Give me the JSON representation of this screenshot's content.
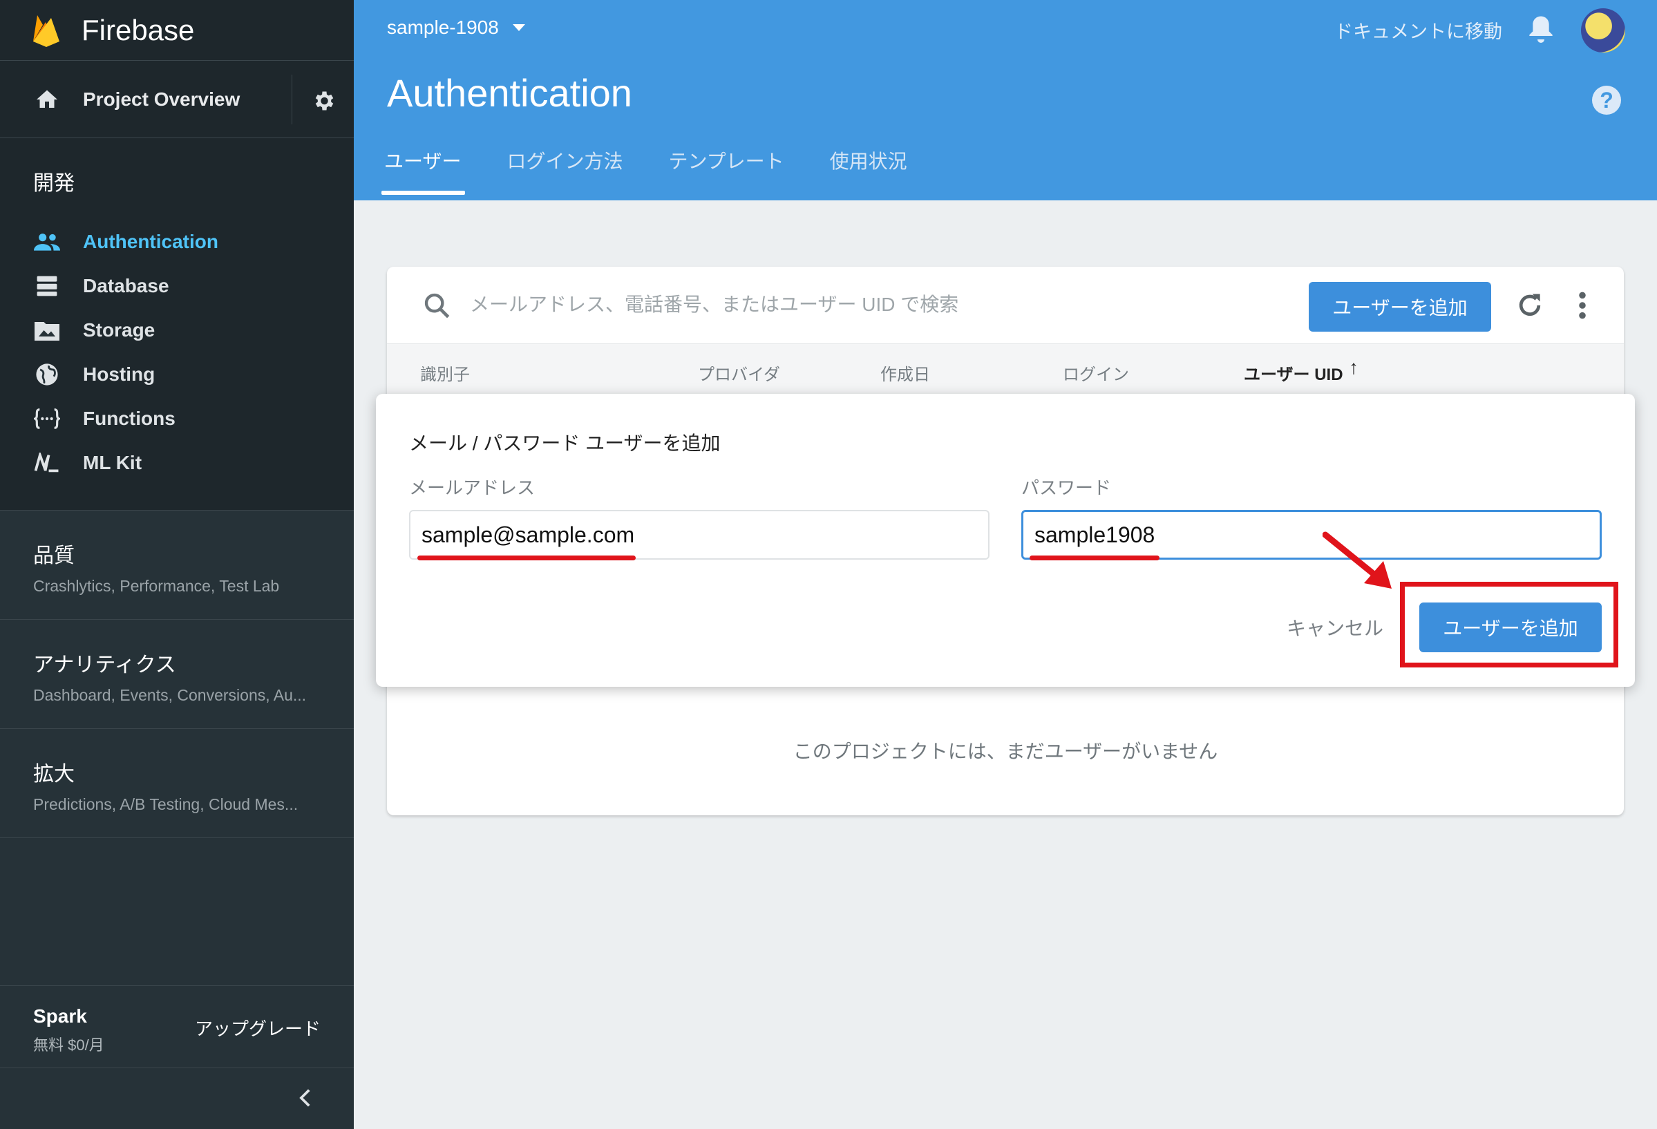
{
  "sidebar": {
    "brand": "Firebase",
    "overview": "Project Overview",
    "dev_title": "開発",
    "items": [
      {
        "label": "Authentication",
        "icon": "users-icon"
      },
      {
        "label": "Database",
        "icon": "database-icon"
      },
      {
        "label": "Storage",
        "icon": "storage-icon"
      },
      {
        "label": "Hosting",
        "icon": "globe-icon"
      },
      {
        "label": "Functions",
        "icon": "functions-icon"
      },
      {
        "label": "ML Kit",
        "icon": "mlkit-icon"
      }
    ],
    "groups": [
      {
        "title": "品質",
        "sub": "Crashlytics, Performance, Test Lab"
      },
      {
        "title": "アナリティクス",
        "sub": "Dashboard, Events, Conversions, Au..."
      },
      {
        "title": "拡大",
        "sub": "Predictions, A/B Testing, Cloud Mes..."
      }
    ],
    "plan": {
      "name": "Spark",
      "price": "無料 $0/月",
      "upgrade": "アップグレード"
    }
  },
  "header": {
    "project": "sample-1908",
    "docs": "ドキュメントに移動",
    "title": "Authentication",
    "help": "?",
    "tabs": [
      "ユーザー",
      "ログイン方法",
      "テンプレート",
      "使用状況"
    ]
  },
  "card": {
    "search_placeholder": "メールアドレス、電話番号、またはユーザー UID で検索",
    "add_user": "ユーザーを追加",
    "columns": [
      "識別子",
      "プロバイダ",
      "作成日",
      "ログイン",
      "ユーザー UID"
    ],
    "sort_arrow": "↑",
    "empty": "このプロジェクトには、まだユーザーがいません"
  },
  "dialog": {
    "title": "メール / パスワード ユーザーを追加",
    "email_label": "メールアドレス",
    "email_value": "sample@sample.com",
    "password_label": "パスワード",
    "password_value": "sample1908",
    "cancel": "キャンセル",
    "add_user": "ユーザーを追加"
  },
  "colors": {
    "accent": "#4298e0",
    "sidebar": "#263238",
    "annotation": "#e0141b",
    "active_item": "#4fc3f7"
  }
}
